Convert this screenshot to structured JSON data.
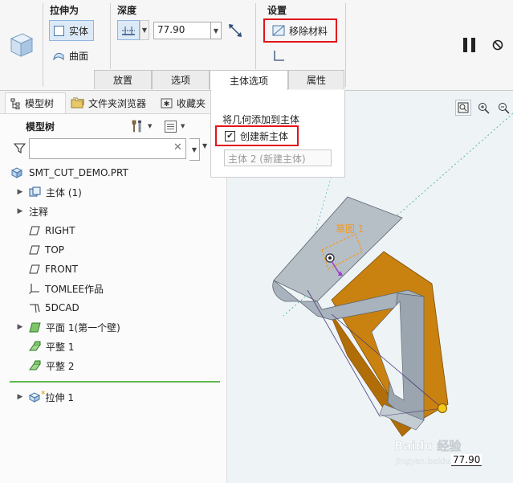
{
  "ribbon": {
    "extrude_as": {
      "title": "拉伸为",
      "solid_label": "实体",
      "surface_label": "曲面"
    },
    "depth": {
      "title": "深度",
      "value": "77.90"
    },
    "settings": {
      "title": "设置",
      "remove_material_label": "移除材料"
    },
    "tabs": [
      {
        "label": "放置"
      },
      {
        "label": "选项"
      },
      {
        "label": "主体选项"
      },
      {
        "label": "属性"
      }
    ]
  },
  "body_panel": {
    "heading": "将几何添加到主体",
    "create_new_body_label": "创建新主体",
    "create_new_body_checked": true,
    "body_field": "主体 2 (新建主体)"
  },
  "left_tabs": [
    {
      "label": "模型树"
    },
    {
      "label": "文件夹浏览器"
    },
    {
      "label": "收藏夹"
    }
  ],
  "model_tree": {
    "heading": "模型树",
    "root": "SMT_CUT_DEMO.PRT",
    "items": [
      {
        "label": "主体 (1)",
        "icon": "body-icon",
        "expandable": true
      },
      {
        "label": "注释",
        "icon": "",
        "expandable": true
      },
      {
        "label": "RIGHT",
        "icon": "datum-plane-icon",
        "expandable": false
      },
      {
        "label": "TOP",
        "icon": "datum-plane-icon",
        "expandable": false
      },
      {
        "label": "FRONT",
        "icon": "datum-plane-icon",
        "expandable": false
      },
      {
        "label": "TOMLEE作品",
        "icon": "coordinate-system-icon",
        "expandable": false
      },
      {
        "label": "5DCAD",
        "icon": "csys-icon",
        "expandable": false
      },
      {
        "label": "平面 1(第一个壁)",
        "icon": "sheetmetal-wall-icon",
        "expandable": true
      },
      {
        "label": "平整 1",
        "icon": "flat-wall-icon",
        "expandable": false
      },
      {
        "label": "平整 2",
        "icon": "flat-wall-icon",
        "expandable": false
      }
    ],
    "insert_item": {
      "label": "拉伸 1",
      "marker": "*"
    }
  },
  "viewport": {
    "sketch_label": "草图 1",
    "dimension": "77.90",
    "watermark_brand": "Baidu 经验",
    "watermark_url": "jingyan.baidu.com"
  },
  "colors": {
    "highlight_red": "#e3141b",
    "sheet_metal_gray": "#a9b3bd",
    "cut_orange": "#c9810f",
    "sketch_orange": "#f59b1a",
    "selection_blue": "#8fb4dd"
  }
}
